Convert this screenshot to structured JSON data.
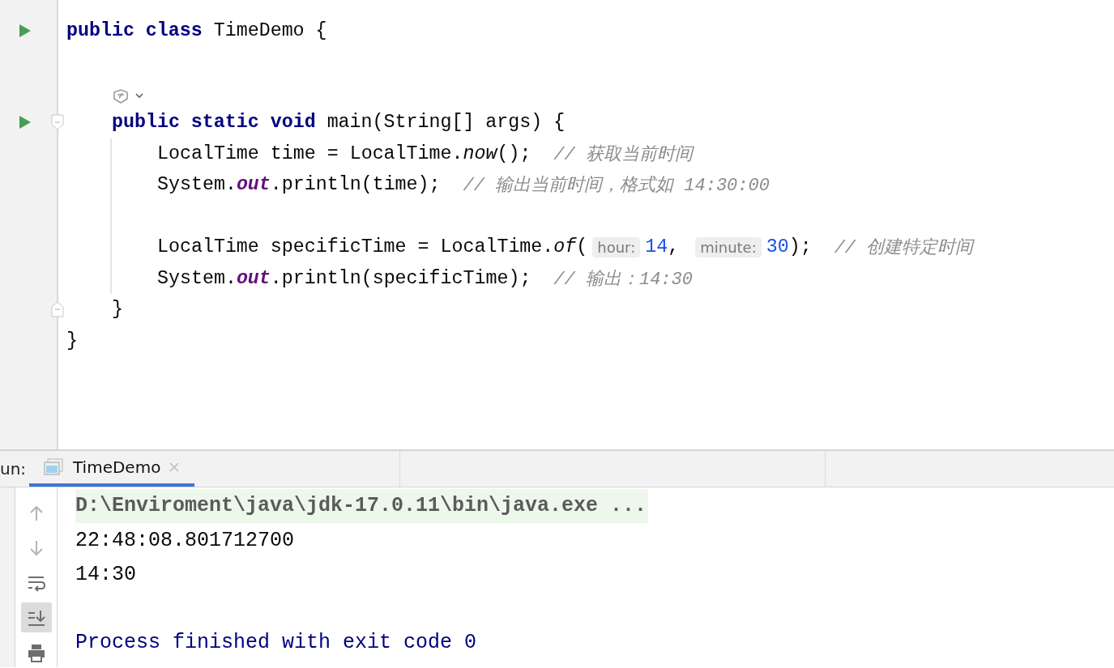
{
  "editor": {
    "lines": [
      {
        "run": true,
        "vision": false,
        "fold_marks": false,
        "tokens": [
          {
            "kind": "keyword",
            "text": "public class"
          },
          {
            "kind": "plain",
            "text": " TimeDemo {"
          }
        ],
        "close": "}",
        "children": [
          {
            "run": false,
            "vision": false
          },
          {
            "run": true,
            "vision": true,
            "fold_marks": true,
            "tokens": [
              {
                "kind": "keyword",
                "text": "public static void"
              },
              {
                "kind": "plain",
                "text": " main(String[] args) {"
              }
            ],
            "close": "}",
            "children": [
              {
                "run": false,
                "vision": false,
                "tokens": [
                  {
                    "kind": "plain",
                    "text": "LocalTime time = LocalTime."
                  },
                  {
                    "kind": "method",
                    "text": "now"
                  },
                  {
                    "kind": "plain",
                    "text": "();  "
                  },
                  {
                    "kind": "comment",
                    "text": "// 获取当前时间"
                  }
                ]
              },
              {
                "run": false,
                "vision": false,
                "tokens": [
                  {
                    "kind": "plain",
                    "text": "System."
                  },
                  {
                    "kind": "field",
                    "text": "out"
                  },
                  {
                    "kind": "plain",
                    "text": ".println(time);  "
                  },
                  {
                    "kind": "comment",
                    "text": "// 输出当前时间，格式如 14:30:00"
                  }
                ]
              },
              {
                "run": false,
                "vision": false
              },
              {
                "run": false,
                "vision": false,
                "tokens": [
                  {
                    "kind": "plain",
                    "text": "LocalTime specificTime = LocalTime."
                  },
                  {
                    "kind": "method",
                    "text": "of"
                  },
                  {
                    "kind": "plain",
                    "text": "("
                  },
                  {
                    "kind": "hint",
                    "text": "hour:"
                  },
                  {
                    "kind": "number",
                    "text": "14"
                  },
                  {
                    "kind": "plain",
                    "text": ", "
                  },
                  {
                    "kind": "hint",
                    "text": "minute:"
                  },
                  {
                    "kind": "number",
                    "text": "30"
                  },
                  {
                    "kind": "plain",
                    "text": ");  "
                  },
                  {
                    "kind": "comment",
                    "text": "// 创建特定时间"
                  }
                ]
              },
              {
                "run": false,
                "vision": false,
                "tokens": [
                  {
                    "kind": "plain",
                    "text": "System."
                  },
                  {
                    "kind": "field",
                    "text": "out"
                  },
                  {
                    "kind": "plain",
                    "text": ".println(specificTime);  "
                  },
                  {
                    "kind": "comment",
                    "text": "// 输出：14:30"
                  }
                ]
              }
            ]
          }
        ]
      }
    ]
  },
  "run_panel": {
    "label": "un:",
    "tabs": [
      {
        "label": "TimeDemo",
        "selected": true
      }
    ],
    "toolbar": [
      {
        "kind": "up",
        "on": false
      },
      {
        "kind": "down",
        "on": false
      },
      {
        "kind": "wrap",
        "on": false
      },
      {
        "kind": "scroll-end",
        "on": true
      },
      {
        "kind": "print",
        "on": false
      }
    ],
    "console": [
      {
        "kind": "command",
        "text": "D:\\Enviroment\\java\\jdk-17.0.11\\bin\\java.exe ..."
      },
      {
        "kind": "output",
        "text": "22:48:08.801712700"
      },
      {
        "kind": "output",
        "text": "14:30"
      },
      {
        "kind": "blank"
      },
      {
        "kind": "exit",
        "text": "Process finished with exit code 0"
      }
    ]
  }
}
